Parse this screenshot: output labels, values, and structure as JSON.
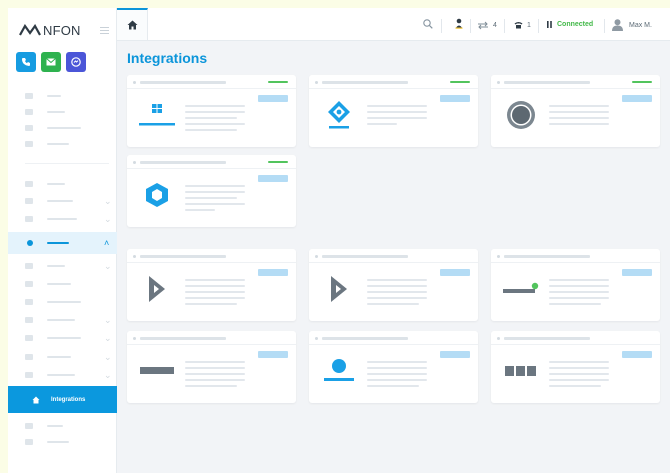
{
  "brand": {
    "name": "NFON",
    "accent": "#0b95da",
    "connected_color": "#43b949"
  },
  "quick_actions": [
    {
      "name": "phone-button",
      "icon": "phone-icon",
      "color": "#169ce1"
    },
    {
      "name": "mail-button",
      "icon": "mail-icon",
      "color": "#2eb24f"
    },
    {
      "name": "chat-button",
      "icon": "chat-icon",
      "color": "#4b56d8"
    }
  ],
  "topbar": {
    "home_icon": "home-icon",
    "search_icon": "search-icon",
    "forward_icon": "call-forward-icon",
    "forward_count": "4",
    "phone_icon": "desk-phone-icon",
    "phone_count": "1",
    "status_icon": "pause-icon",
    "status": "Connected",
    "user_icon": "user-icon",
    "user": "Max M."
  },
  "sidebar": {
    "active_item": "Integrations",
    "active_icon": "house-icon"
  },
  "main": {
    "title": "Integrations",
    "cards": [
      {
        "logo": "windows-icon",
        "connected": true
      },
      {
        "logo": "azure-ad-icon",
        "connected": true
      },
      {
        "logo": "circle-logo-icon",
        "connected": true
      },
      {
        "logo": "hexagon-shield-icon",
        "connected": true
      },
      {
        "logo": "dynamics-icon",
        "connected": false
      },
      {
        "logo": "dynamics-icon",
        "connected": false
      },
      {
        "logo": "status-line-icon",
        "connected": false
      },
      {
        "logo": "bar-logo-icon",
        "connected": false
      },
      {
        "logo": "person-logo-icon",
        "connected": false
      },
      {
        "logo": "grid-logo-icon",
        "connected": false
      }
    ]
  }
}
